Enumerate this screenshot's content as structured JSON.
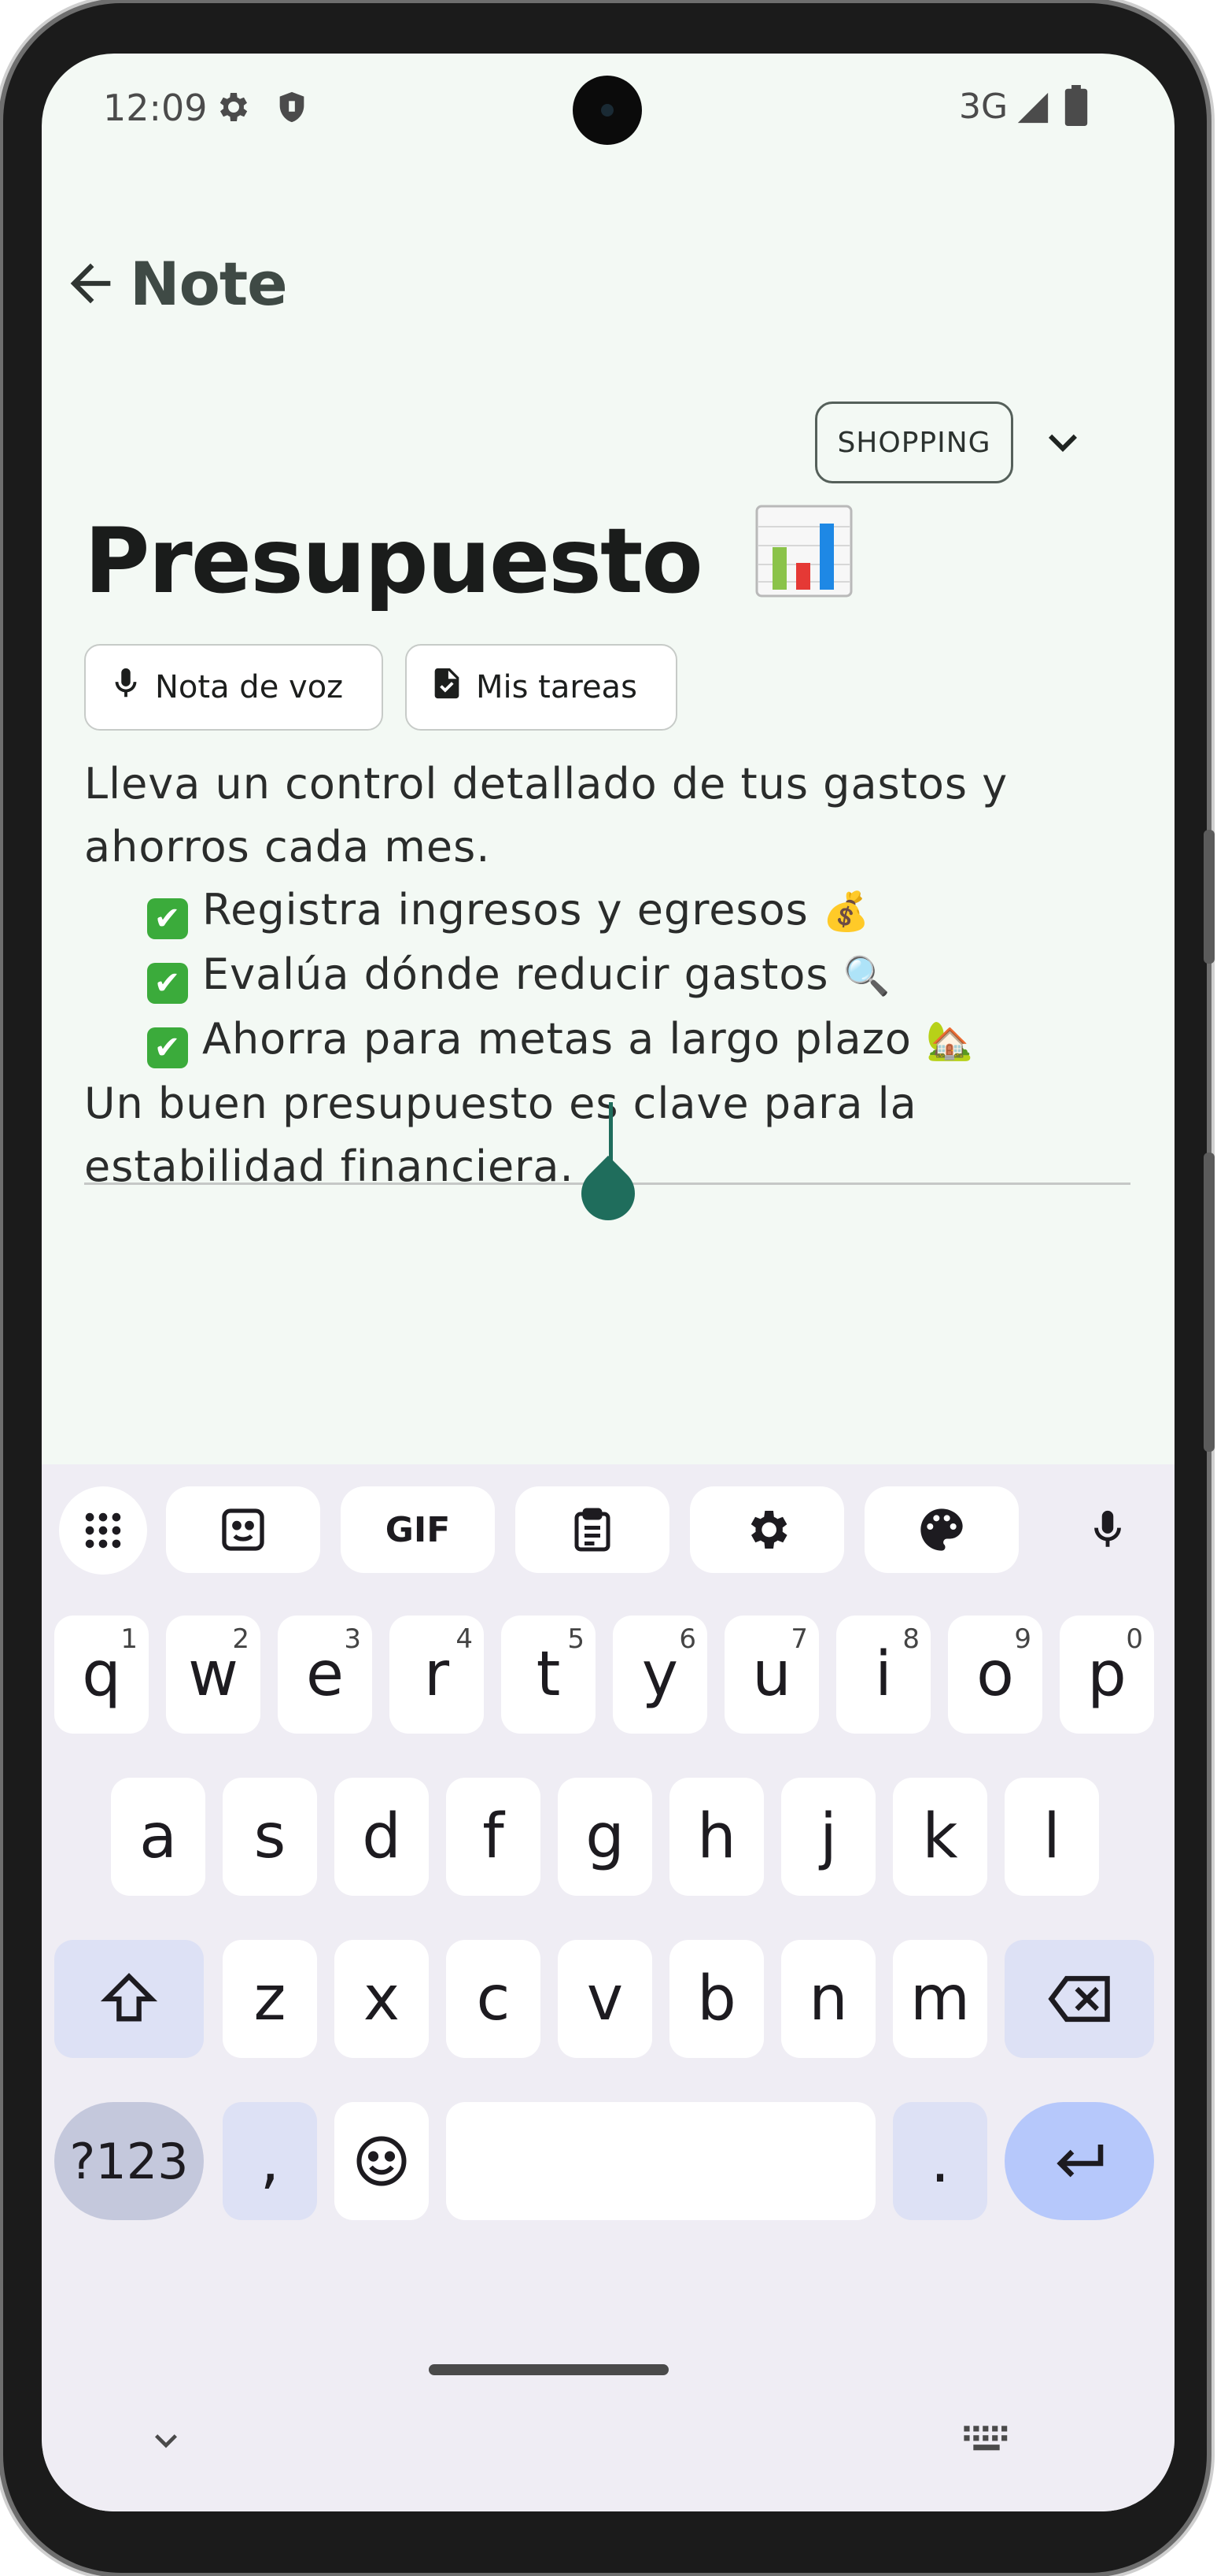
{
  "status_bar": {
    "time": "12:09",
    "network": "3G",
    "icons": [
      "gear-icon",
      "shield-icon",
      "signal-icon",
      "battery-icon"
    ]
  },
  "app_bar": {
    "title": "Note",
    "back_icon": "arrow-back-icon"
  },
  "category": {
    "label": "SHOPPING",
    "dropdown_icon": "chevron-down-icon"
  },
  "note": {
    "title": "Presupuesto",
    "title_icon": "bar-chart-emoji",
    "chips": [
      {
        "label": "Nota de voz",
        "icon": "mic-icon"
      },
      {
        "label": "Mis tareas",
        "icon": "task-file-icon"
      }
    ],
    "lines": {
      "l1": "Lleva un control detallado de tus gastos y",
      "l2": "ahorros cada mes.",
      "c1": "Registra ingresos y egresos",
      "c1_emoji": "💰",
      "c2": "Evalúa dónde reducir gastos",
      "c2_emoji": "🔍",
      "c3": "Ahorra para metas a largo plazo",
      "c3_emoji": "🏡",
      "l3": "Un buen presupuesto es clave para la",
      "l4": "estabilidad financiera."
    },
    "check_mark": "✔"
  },
  "keyboard": {
    "toolbar": [
      "apps-grid-icon",
      "sticker-icon",
      "gif-icon",
      "clipboard-icon",
      "settings-icon",
      "palette-icon",
      "mic-icon"
    ],
    "gif_label": "GIF",
    "row1": [
      "q",
      "w",
      "e",
      "r",
      "t",
      "y",
      "u",
      "i",
      "o",
      "p"
    ],
    "row1_hints": [
      "1",
      "2",
      "3",
      "4",
      "5",
      "6",
      "7",
      "8",
      "9",
      "0"
    ],
    "row2": [
      "a",
      "s",
      "d",
      "f",
      "g",
      "h",
      "j",
      "k",
      "l"
    ],
    "row3": [
      "z",
      "x",
      "c",
      "v",
      "b",
      "n",
      "m"
    ],
    "sym_label": "?123",
    "comma": ",",
    "period": "."
  },
  "colors": {
    "screen_bg": "#f3f9f4",
    "accent": "#1f6d5c",
    "keyboard_bg": "#efedf4",
    "enter_key": "#b6c8fb"
  }
}
